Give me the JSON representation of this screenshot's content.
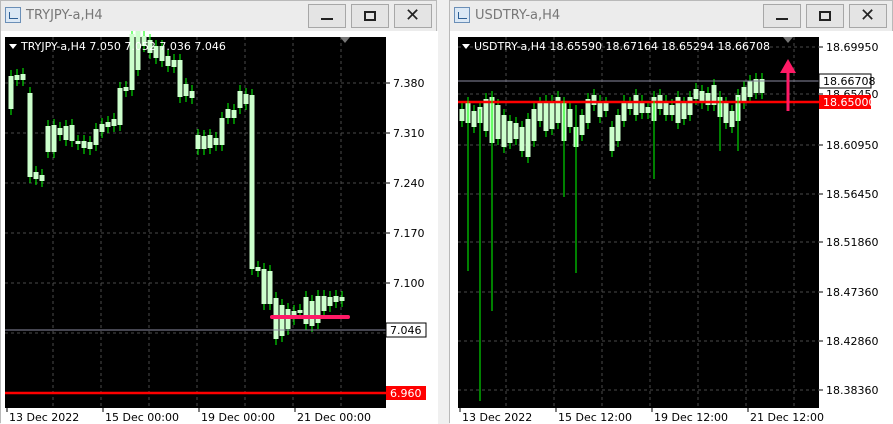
{
  "windows": [
    {
      "id": "left",
      "title": "TRYJPY-a,H4",
      "header": "TRYJPY-a,H4  7.050 7.052 7.036 7.046",
      "price_labels": [
        "7.380",
        "7.310",
        "7.240",
        "7.170",
        "7.100",
        "7.035"
      ],
      "current_price": "7.046",
      "level_price": "6.960",
      "time_labels": [
        "13 Dec 2022",
        "15 Dec 00:00",
        "19 Dec 00:00",
        "21 Dec 00:00"
      ],
      "colors": {
        "bg": "#000000",
        "candle": "#ccffcc",
        "wick": "#00ff00",
        "level": "#ff0000",
        "marker": "#ff1a66"
      }
    },
    {
      "id": "right",
      "title": "USDTRY-a,H4",
      "header": "USDTRY-a,H4  18.65590 18.67164 18.65294 18.66708",
      "price_labels": [
        "18.69950",
        "18.65450",
        "18.60950",
        "18.56450",
        "18.51860",
        "18.47360",
        "18.42860",
        "18.38360"
      ],
      "current_price": "18.66708",
      "level_price": "18.65000",
      "time_labels": [
        "13 Dec 2022",
        "15 Dec 12:00",
        "19 Dec 12:00",
        "21 Dec 12:00"
      ],
      "colors": {
        "bg": "#000000",
        "candle": "#ccffcc",
        "wick": "#00ff00",
        "level": "#ff0000",
        "marker": "#ff1a66"
      }
    }
  ],
  "controls": {
    "minimize": "minimize",
    "maximize": "maximize",
    "close": "✕"
  }
}
